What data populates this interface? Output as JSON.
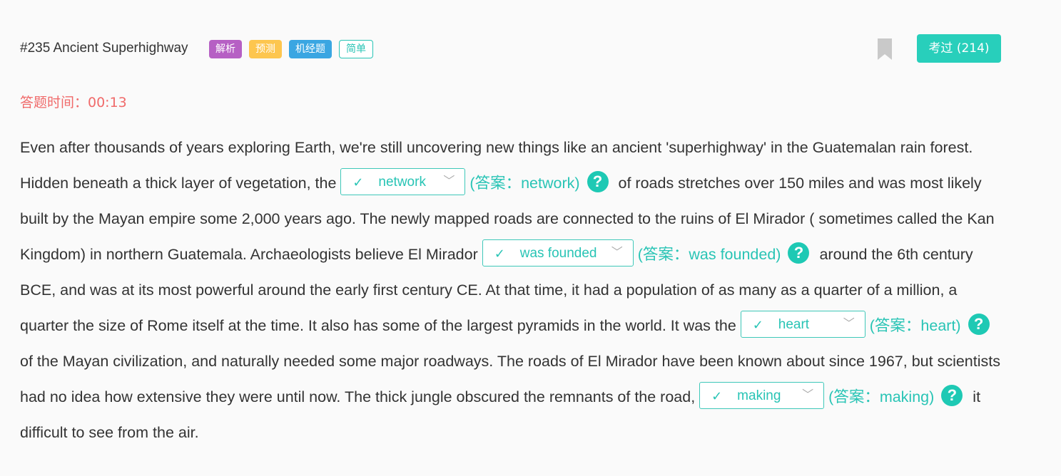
{
  "header": {
    "title": "#235 Ancient Superhighway",
    "tags": [
      "解析",
      "预测",
      "机经题",
      "简单"
    ],
    "exam_button": "考过 (214)"
  },
  "timer": "答题时间：00:13",
  "colors": {
    "accent": "#28cfbb",
    "timer": "#f06a6a",
    "tag_purple": "#b660c4",
    "tag_yellow": "#fdc64f",
    "tag_blue": "#3aa6e2"
  },
  "passage": {
    "t1": "Even after thousands of years exploring Earth, we're still uncovering new things like an ancient 'superhighway' in the Guatemalan rain forest. Hidden beneath a thick layer of vegetation, the ",
    "b1": {
      "value": "network",
      "answer": "(答案：network)"
    },
    "t2": "of roads stretches over 150 miles and was most likely built by the Mayan empire some 2,000 years ago. The newly mapped roads are connected to the ruins of El Mirador ( sometimes called the Kan Kingdom) in northern Guatemala. Archaeologists believe El Mirador ",
    "b2": {
      "value": "was founded",
      "answer": "(答案：was founded)"
    },
    "t3": "around the 6th century BCE, and was at its most powerful around the early first century CE. At that time, it had a population of as many as a quarter of a million, a quarter the size of Rome itself at the time. It also has some of the largest pyramids in the world. It was the ",
    "b3": {
      "value": "heart",
      "answer": "(答案：heart)"
    },
    "t4": "of the Mayan civilization, and naturally needed some major roadways. The roads of El Mirador have been known about since 1967, but scientists had no idea how extensive they were until now. The thick jungle obscured the remnants of the road, ",
    "b4": {
      "value": "making",
      "answer": "(答案：making)"
    },
    "t5": "it difficult to see from the air.",
    "check_icon": "check-icon",
    "arrow_icon": "chevron-down-icon",
    "help_icon": "question-icon",
    "help_symbol": "?"
  }
}
